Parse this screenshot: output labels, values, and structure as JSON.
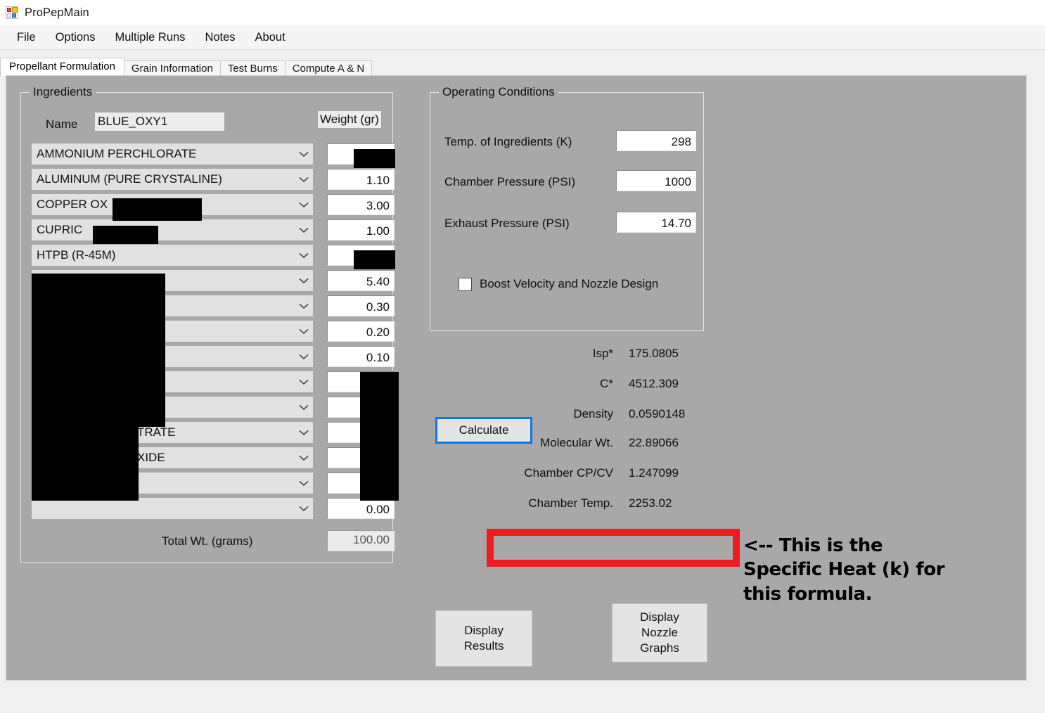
{
  "window": {
    "title": "ProPepMain",
    "icon": "app-window-grid-icon"
  },
  "menu": {
    "items": [
      {
        "label": "File"
      },
      {
        "label": "Options"
      },
      {
        "label": "Multiple Runs"
      },
      {
        "label": "Notes"
      },
      {
        "label": "About"
      }
    ]
  },
  "tabs": [
    {
      "label": "Propellant Formulation",
      "active": true
    },
    {
      "label": "Grain Information",
      "active": false
    },
    {
      "label": "Test Burns",
      "active": false
    },
    {
      "label": "Compute A & N",
      "active": false
    }
  ],
  "ingredients": {
    "group_title": "Ingredients",
    "name_label": "Name",
    "name_value": "BLUE_OXY1",
    "weight_header": "Weight (gr)",
    "total_label": "Total Wt. (grams)",
    "total_value": "100.00",
    "rows": [
      {
        "ingredient": "AMMONIUM PERCHLORATE",
        "weight": ""
      },
      {
        "ingredient": "ALUMINUM (PURE CRYSTALINE)",
        "weight": "1.10"
      },
      {
        "ingredient": "COPPER OX",
        "weight": "3.00"
      },
      {
        "ingredient": "CUPRIC ",
        "weight": "1.00"
      },
      {
        "ingredient": "HTPB (R-45M)",
        "weight": ""
      },
      {
        "ingredient": "",
        "weight": "5.40"
      },
      {
        "ingredient": "",
        "weight": "0.30"
      },
      {
        "ingredient": "",
        "weight": "0.20"
      },
      {
        "ingredient": "",
        "weight": "0.10"
      },
      {
        "ingredient": "",
        "weight": ""
      },
      {
        "ingredient": "",
        "weight": ""
      },
      {
        "ingredient": "TRATE",
        "weight": ""
      },
      {
        "ingredient": "XIDE",
        "weight": ""
      },
      {
        "ingredient": "",
        "weight": ""
      },
      {
        "ingredient": "",
        "weight": "0.00"
      }
    ]
  },
  "operating_conditions": {
    "group_title": "Operating Conditions",
    "fields": [
      {
        "label": "Temp. of Ingredients (K)",
        "value": "298"
      },
      {
        "label": "Chamber Pressure (PSI)",
        "value": "1000"
      },
      {
        "label": "Exhaust Pressure (PSI)",
        "value": "14.70"
      }
    ],
    "checkbox": {
      "label": "Boost Velocity and Nozzle Design",
      "checked": false
    }
  },
  "actions": {
    "calculate_label": "Calculate",
    "display_results_line1": "Display",
    "display_results_line2": "Results",
    "display_nozzle_line1": "Display",
    "display_nozzle_line2": "Nozzle",
    "display_nozzle_line3": "Graphs"
  },
  "results": [
    {
      "label": "Isp*",
      "value": "175.0805"
    },
    {
      "label": "C*",
      "value": "4512.309"
    },
    {
      "label": "Density",
      "value": "0.0590148"
    },
    {
      "label": "Molecular Wt.",
      "value": "22.89066"
    },
    {
      "label": "Chamber CP/CV",
      "value": "1.247099"
    },
    {
      "label": "Chamber Temp.",
      "value": "2253.02"
    }
  ],
  "annotation": {
    "line1": "<-- This is the",
    "line2": "Specific Heat (k) for",
    "line3": "this formula."
  },
  "colors": {
    "panel_gray": "#a8a8a8",
    "highlight_red": "#ee1b20",
    "focus_blue": "#0a7ae0",
    "redaction_black": "#000000"
  }
}
